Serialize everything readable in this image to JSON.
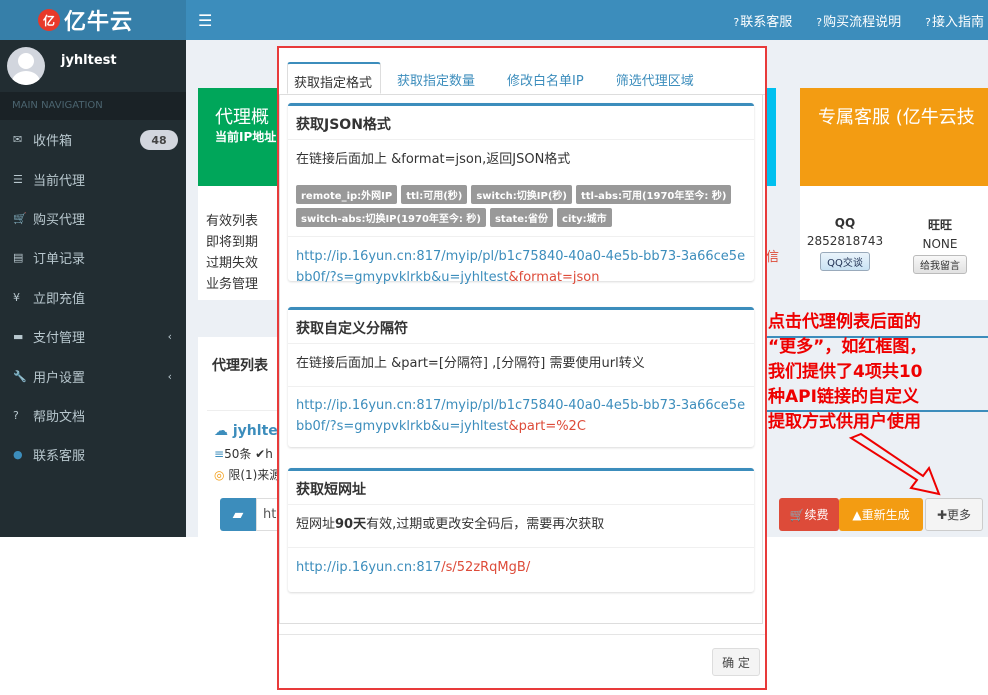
{
  "brand": {
    "badge": "亿",
    "name": "亿牛云"
  },
  "topbar": {
    "menu_icon": "menu-icon",
    "links": [
      "联系客服",
      "购买流程说明",
      "接入指南"
    ],
    "link_icon": "question-circle-icon"
  },
  "sidebar": {
    "username": "jyhltest",
    "header": "MAIN NAVIGATION",
    "items": [
      {
        "label": "收件箱",
        "icon": "envelope-icon",
        "badge": "48"
      },
      {
        "label": "当前代理",
        "icon": "list-icon"
      },
      {
        "label": "购买代理",
        "icon": "cart-icon"
      },
      {
        "label": "订单记录",
        "icon": "list-alt-icon"
      },
      {
        "label": "立即充值",
        "icon": "yen-icon"
      },
      {
        "label": "支付管理",
        "icon": "credit-card-icon",
        "chevron": "‹"
      },
      {
        "label": "用户设置",
        "icon": "wrench-icon",
        "chevron": "‹"
      },
      {
        "label": "帮助文档",
        "icon": "question-icon"
      },
      {
        "label": "联系客服",
        "icon": "user-icon"
      }
    ]
  },
  "background": {
    "green_title": "代理概",
    "green_sub": "当前IP地址",
    "list_labels": [
      "有效列表",
      "即将到期",
      "过期失效",
      "业务管理"
    ],
    "red_frag": "信",
    "orange_title": "专属客服 (亿牛云技",
    "qq": {
      "label": "QQ",
      "value": "2852818743",
      "btn": "QQ交谈"
    },
    "ww": {
      "label": "旺旺",
      "value": "NONE",
      "btn": "给我留言"
    },
    "proxy_list_title": "代理列表",
    "proxy_name": "jyhltes",
    "proxy_count": "50条 ✔h",
    "proxy_limit": "限(1)来源",
    "input_frag": "ht",
    "btn_renew": "续费",
    "btn_regen": "重新生成",
    "btn_more": "更多"
  },
  "annotation": {
    "lines": [
      "点击代理例表后面的",
      "“更多”，如红框图，",
      "我们提供了4项共10",
      "种API链接的自定义",
      "提取方式供用户使用"
    ]
  },
  "modal": {
    "tabs": [
      "获取指定格式",
      "获取指定数量",
      "修改白名单IP",
      "筛选代理区域"
    ],
    "cards": [
      {
        "title": "获取JSON格式",
        "desc": "在链接后面加上 &format=json,返回JSON格式",
        "tags": [
          "remote_ip:外网IP",
          "ttl:可用(秒)",
          "switch:切换IP(秒)",
          "ttl-abs:可用(1970年至今: 秒)",
          "switch-abs:切换IP(1970年至今: 秒)",
          "state:省份",
          "city:城市"
        ],
        "url_main": "http://ip.16yun.cn:817/myip/pl/b1c75840-40a0-4e5b-bb73-3a66ce5ebb0f/?s=gmypvklrkb&u=jyhltest",
        "url_param": "&format=json"
      },
      {
        "title": "获取自定义分隔符",
        "desc": "在链接后面加上 &part=[分隔符] ,[分隔符] 需要使用url转义",
        "url_main": "http://ip.16yun.cn:817/myip/pl/b1c75840-40a0-4e5b-bb73-3a66ce5ebb0f/?s=gmypvklrkb&u=jyhltest",
        "url_param": "&part=%2C"
      },
      {
        "title": "获取短网址",
        "desc_pre": "短网址",
        "desc_bold": "90天",
        "desc_post": "有效,过期或更改安全码后，需要再次获取",
        "url_main": "http://ip.16yun.cn:817",
        "url_param": "/s/52zRqMgB/"
      }
    ],
    "ok": "确 定"
  }
}
